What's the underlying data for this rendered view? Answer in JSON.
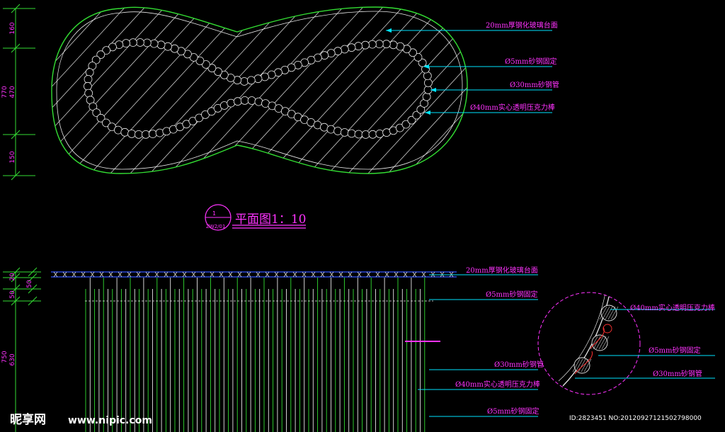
{
  "drawing": {
    "plan_title": "平面图1：10",
    "plan_symbol_top": "1",
    "plan_symbol_bottom": "ZW2/01",
    "plan_labels": [
      "20mm厚钢化玻璃台面",
      "Ø5mm砂钢固定",
      "Ø30mm砂钢管",
      "Ø40mm实心透明压克力棒"
    ],
    "elev_labels": [
      "20mm厚钢化玻璃台面",
      "Ø5mm砂钢固定",
      "Ø30mm砂钢管",
      "Ø40mm实心透明压克力棒",
      "Ø5mm砂钢固定"
    ],
    "detail_labels": [
      "Ø40mm实心透明压克力棒",
      "Ø5mm砂钢固定",
      "Ø30mm砂钢管"
    ],
    "plan_dims": [
      "160",
      "470",
      "770",
      "150"
    ],
    "elev_dims": [
      "20",
      "50",
      "50",
      "630",
      "750"
    ],
    "colors": {
      "magenta": "#ff33ff",
      "green": "#33dd33",
      "white": "#e8e8e8",
      "cyan": "#00e5ff",
      "blue": "#3355ff",
      "red": "#ff3333"
    }
  },
  "watermark": {
    "logo": "昵享网",
    "url": "www.nipic.com",
    "id_text": "ID:2823451 NO:20120927121502798000"
  }
}
